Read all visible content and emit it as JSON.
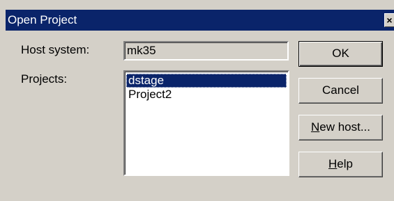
{
  "window": {
    "title": "Open Project",
    "close_glyph": "×"
  },
  "form": {
    "host_label": "Host system:",
    "host_value": "mk35",
    "projects_label": "Projects:",
    "projects": [
      {
        "label": "dstage",
        "selected": true
      },
      {
        "label": "Project2",
        "selected": false
      }
    ]
  },
  "buttons": {
    "ok": "OK",
    "cancel": "Cancel",
    "new_host_accel": "N",
    "new_host_rest": "ew host...",
    "help_accel": "H",
    "help_rest": "elp"
  },
  "colors": {
    "titlebar": "#0a246a",
    "selection": "#0a246a",
    "face": "#d4d0c8"
  }
}
